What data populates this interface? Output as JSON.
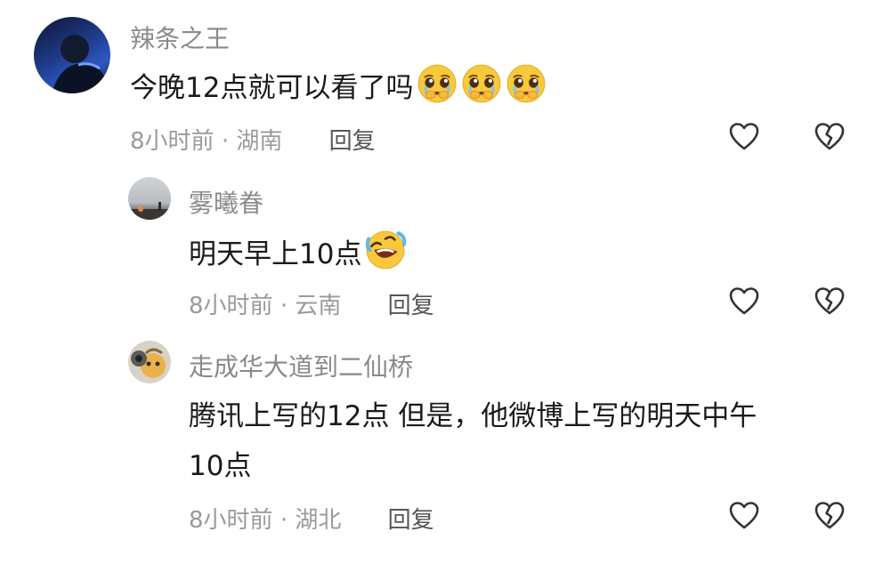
{
  "comments": [
    {
      "username": "辣条之王",
      "text": "今晚12点就可以看了吗",
      "emoji": "pleading-crying-face-emoji x3",
      "time": "8小时前",
      "location": "湖南",
      "reply_label": "回复"
    },
    {
      "username": "雾曦眷",
      "text": "明天早上10点",
      "emoji": "rolling-laughing-face-emoji",
      "time": "8小时前",
      "location": "云南",
      "reply_label": "回复"
    },
    {
      "username": "走成华大道到二仙桥",
      "text_line1": "腾讯上写的12点 但是，他微博上写的明天中午",
      "text_line2": "10点",
      "time": "8小时前",
      "location": "湖北",
      "reply_label": "回复"
    }
  ],
  "separator": "·",
  "icons": {
    "like": "heart-outline-icon",
    "dislike": "broken-heart-outline-icon"
  },
  "colors": {
    "text": "#1a1a1a",
    "meta": "#9a9a9a",
    "username": "#8a8a8a",
    "icon": "#333333"
  }
}
